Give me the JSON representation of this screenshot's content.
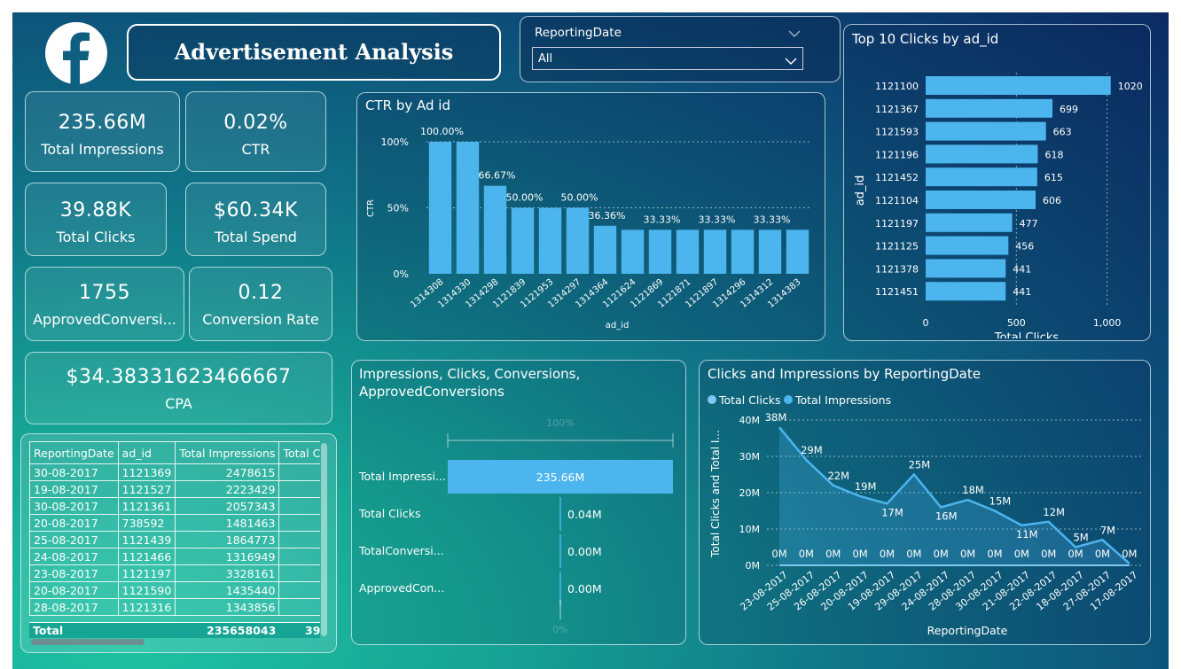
{
  "header": {
    "title": "Advertisement Analysis",
    "logo_icon": "facebook-logo-icon",
    "slicer": {
      "label": "ReportingDate",
      "value": "All"
    }
  },
  "kpis": {
    "impressions": {
      "value": "235.66M",
      "label": "Total Impressions"
    },
    "ctr": {
      "value": "0.02%",
      "label": "CTR"
    },
    "clicks": {
      "value": "39.88K",
      "label": "Total Clicks"
    },
    "spend": {
      "value": "$60.34K",
      "label": "Total Spend"
    },
    "approved": {
      "value": "1755",
      "label": "ApprovedConversi..."
    },
    "conv_rate": {
      "value": "0.12",
      "label": "Conversion Rate"
    },
    "cpa": {
      "value": "$34.38331623466667",
      "label": "CPA"
    }
  },
  "table": {
    "columns": [
      "ReportingDate",
      "ad_id",
      "Total Impressions",
      "Total Cl"
    ],
    "rows": [
      [
        "30-08-2017",
        "1121369",
        "2478615"
      ],
      [
        "19-08-2017",
        "1121527",
        "2223429"
      ],
      [
        "30-08-2017",
        "1121361",
        "2057343"
      ],
      [
        "20-08-2017",
        "738592",
        "1481463"
      ],
      [
        "25-08-2017",
        "1121439",
        "1864773"
      ],
      [
        "24-08-2017",
        "1121466",
        "1316949"
      ],
      [
        "23-08-2017",
        "1121197",
        "3328161"
      ],
      [
        "20-08-2017",
        "1121590",
        "1435440"
      ],
      [
        "28-08-2017",
        "1121316",
        "1343856"
      ]
    ],
    "total": [
      "Total",
      "",
      "235658043",
      "39"
    ]
  },
  "chart_data": [
    {
      "id": "ctr",
      "type": "bar",
      "title": "CTR by Ad id",
      "xlabel": "ad_id",
      "ylabel": "CTR",
      "yticks": [
        "0%",
        "50%",
        "100%"
      ],
      "ylim": [
        0,
        100
      ],
      "categories": [
        "1314308",
        "1314330",
        "1314298",
        "1121839",
        "1121953",
        "1314297",
        "1314364",
        "1121624",
        "1121869",
        "1121871",
        "1121897",
        "1314296",
        "1314312",
        "1314383"
      ],
      "values": [
        100,
        100,
        66.67,
        50,
        50,
        50,
        36.36,
        33.33,
        33.33,
        33.33,
        33.33,
        33.33,
        33.33,
        33.33
      ],
      "labels": [
        "100.00%",
        "",
        "66.67%",
        "50.00%",
        "",
        "50.00%",
        "36.36%",
        "",
        "33.33%",
        "",
        "33.33%",
        "",
        "33.33%",
        ""
      ],
      "color": "#4db5ee"
    },
    {
      "id": "top10",
      "type": "bar",
      "orientation": "horizontal",
      "title": "Top 10 Clicks by ad_id",
      "xlabel": "Total Clicks",
      "ylabel": "ad_id",
      "xticks": [
        "0",
        "500",
        "1,000"
      ],
      "xlim": [
        0,
        1080
      ],
      "categories": [
        "1121100",
        "1121367",
        "1121593",
        "1121196",
        "1121452",
        "1121104",
        "1121197",
        "1121125",
        "1121378",
        "1121451"
      ],
      "values": [
        1020,
        699,
        663,
        618,
        615,
        606,
        477,
        456,
        441,
        441
      ],
      "labels": [
        "1020",
        "699",
        "663",
        "618",
        "615",
        "606",
        "477",
        "456",
        "441",
        "441"
      ],
      "color": "#4db5ee"
    },
    {
      "id": "funnel",
      "type": "bar",
      "orientation": "horizontal",
      "title": "Impressions, Clicks, Conversions, ApprovedConversions",
      "top_label": "100%",
      "bottom_label": "0%",
      "categories": [
        "Total Impressi...",
        "Total Clicks",
        "TotalConversi...",
        "ApprovedCon..."
      ],
      "values": [
        235.66,
        0.04,
        0.0,
        0.0
      ],
      "labels": [
        "235.66M",
        "0.04M",
        "0.00M",
        "0.00M"
      ],
      "color": "#4db5ee"
    },
    {
      "id": "area",
      "type": "area",
      "title": "Clicks and Impressions by ReportingDate",
      "xlabel": "ReportingDate",
      "ylabel": "Total Clicks and Total I...",
      "yticks": [
        "0M",
        "10M",
        "20M",
        "30M",
        "40M"
      ],
      "ylim": [
        0,
        40
      ],
      "legend": [
        "Total Clicks",
        "Total Impressions"
      ],
      "categories": [
        "23-08-2017",
        "25-08-2017",
        "26-08-2017",
        "20-08-2017",
        "19-08-2017",
        "29-08-2017",
        "24-08-2017",
        "28-08-2017",
        "30-08-2017",
        "21-08-2017",
        "22-08-2017",
        "18-08-2017",
        "27-08-2017",
        "17-08-2017"
      ],
      "series": [
        {
          "name": "Total Impressions",
          "values": [
            38,
            29,
            22,
            19,
            17,
            25,
            16,
            18,
            15,
            11,
            12,
            5,
            7,
            0.5
          ],
          "labels": [
            "38M",
            "29M",
            "22M",
            "19M",
            "17M",
            "25M",
            "16M",
            "18M",
            "15M",
            "11M",
            "12M",
            "5M",
            "7M",
            ""
          ]
        },
        {
          "name": "Total Clicks",
          "values": [
            0,
            0,
            0,
            0,
            0,
            0,
            0,
            0,
            0,
            0,
            0,
            0,
            0,
            0
          ],
          "labels": [
            "0M",
            "0M",
            "0M",
            "0M",
            "0M",
            "0M",
            "0M",
            "0M",
            "0M",
            "0M",
            "0M",
            "0M",
            "0M",
            "0M"
          ]
        }
      ],
      "color": "#4db5ee"
    }
  ]
}
